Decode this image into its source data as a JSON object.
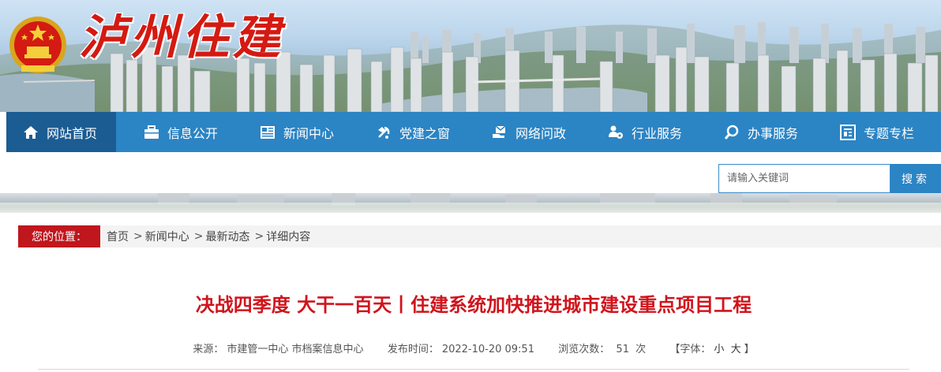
{
  "site": {
    "title": "泸州住建"
  },
  "nav": {
    "items": [
      {
        "label": "网站首页",
        "icon": "home-icon",
        "active": true
      },
      {
        "label": "信息公开",
        "icon": "briefcase-icon"
      },
      {
        "label": "新闻中心",
        "icon": "newspaper-icon"
      },
      {
        "label": "党建之窗",
        "icon": "party-emblem-icon"
      },
      {
        "label": "网络问政",
        "icon": "mail-hand-icon"
      },
      {
        "label": "行业服务",
        "icon": "users-gear-icon"
      },
      {
        "label": "办事服务",
        "icon": "search-icon"
      },
      {
        "label": "专题专栏",
        "icon": "column-icon"
      }
    ]
  },
  "search": {
    "placeholder": "请输入关键词",
    "button": "搜索"
  },
  "breadcrumb": {
    "label": "您的位置：",
    "items": [
      "首页",
      "新闻中心",
      "最新动态",
      "详细内容"
    ],
    "separator": ">"
  },
  "article": {
    "title": "决战四季度 大干一百天丨住建系统加快推进城市建设重点项目工程",
    "source_label": "来源：",
    "source": "市建管一中心 市档案信息中心",
    "date_label": "发布时间：",
    "date": "2022-10-20 09:51",
    "views_label": "浏览次数：",
    "views": "51",
    "views_unit": "次",
    "font_label": "【字体：",
    "font_small": "小",
    "font_large": "大",
    "font_close": "】"
  },
  "colors": {
    "nav": "#2b84c4",
    "nav_active": "#1b5c93",
    "title_red": "#d0141c",
    "crumb_red": "#c0161d"
  }
}
